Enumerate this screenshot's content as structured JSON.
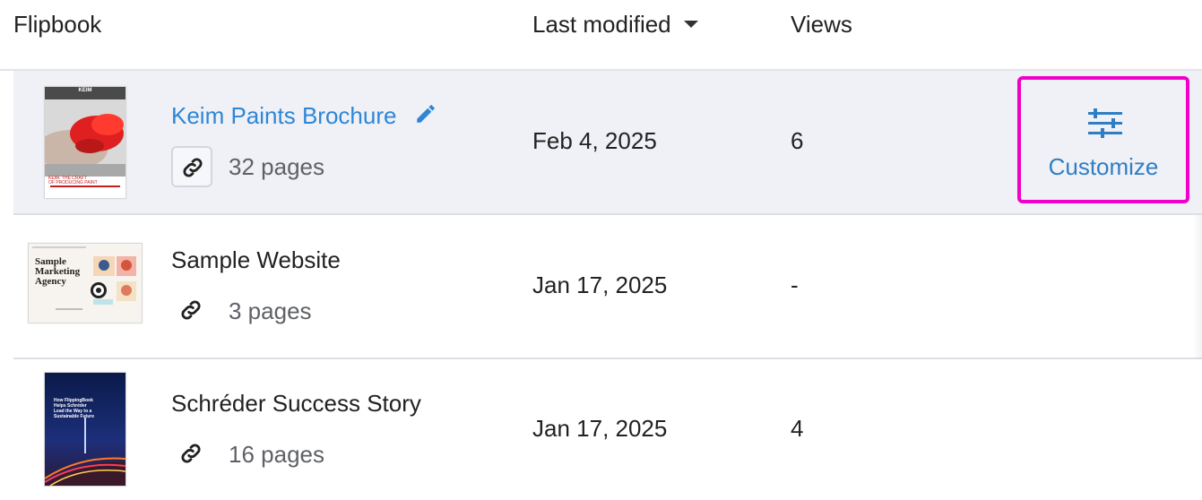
{
  "columns": {
    "flipbook": "Flipbook",
    "last_modified": "Last modified",
    "views": "Views"
  },
  "rows": [
    {
      "title": "Keim Paints Brochure",
      "pages": "32 pages",
      "modified": "Feb 4, 2025",
      "views": "6",
      "thumb": {
        "brand": "KEIM",
        "headline_1": "KEIM. THE CRAFT",
        "headline_2": "OF PRODUCING PAINT"
      }
    },
    {
      "title": "Sample Website",
      "pages": "3 pages",
      "modified": "Jan 17, 2025",
      "views": "-",
      "thumb": {
        "headline_1": "Sample",
        "headline_2": "Marketing",
        "headline_3": "Agency"
      }
    },
    {
      "title": "Schréder Success Story",
      "pages": "16 pages",
      "modified": "Jan 17, 2025",
      "views": "4",
      "thumb": {
        "headline_1": "How FlippingBook",
        "headline_2": "Helps Schréder",
        "headline_3": "Lead the Way to a",
        "headline_4": "Sustainable Future"
      }
    }
  ],
  "actions": {
    "customize_label": "Customize"
  },
  "colors": {
    "link_blue": "#2f86d6",
    "customize_blue": "#2f7ec4",
    "highlight_magenta": "#f000c8",
    "selected_row_bg": "#eff1f6"
  },
  "icons": [
    "sort-desc-icon",
    "edit-pencil-icon",
    "link-icon",
    "sliders-icon"
  ]
}
